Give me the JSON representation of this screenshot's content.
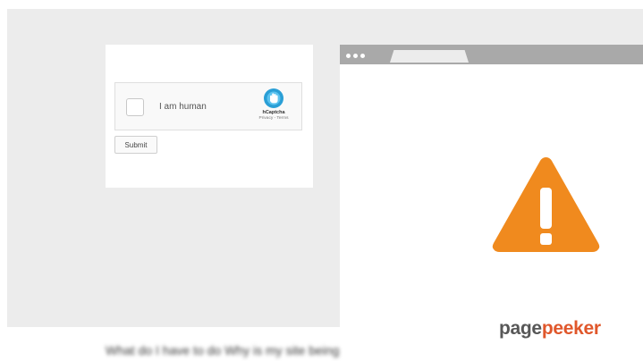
{
  "captcha": {
    "label": "I am human",
    "brand": "hCaptcha",
    "links": "Privacy - Terms",
    "brand_color": "#2a9fd6"
  },
  "form": {
    "submit_label": "Submit"
  },
  "error_icon": {
    "name": "warning-icon",
    "color": "#f08a1e"
  },
  "watermark": {
    "part1": "page",
    "part2": "peeker",
    "color1": "#575757",
    "color2": "#e0572b"
  },
  "footer_text": "What do I have to do     Why is my site being"
}
